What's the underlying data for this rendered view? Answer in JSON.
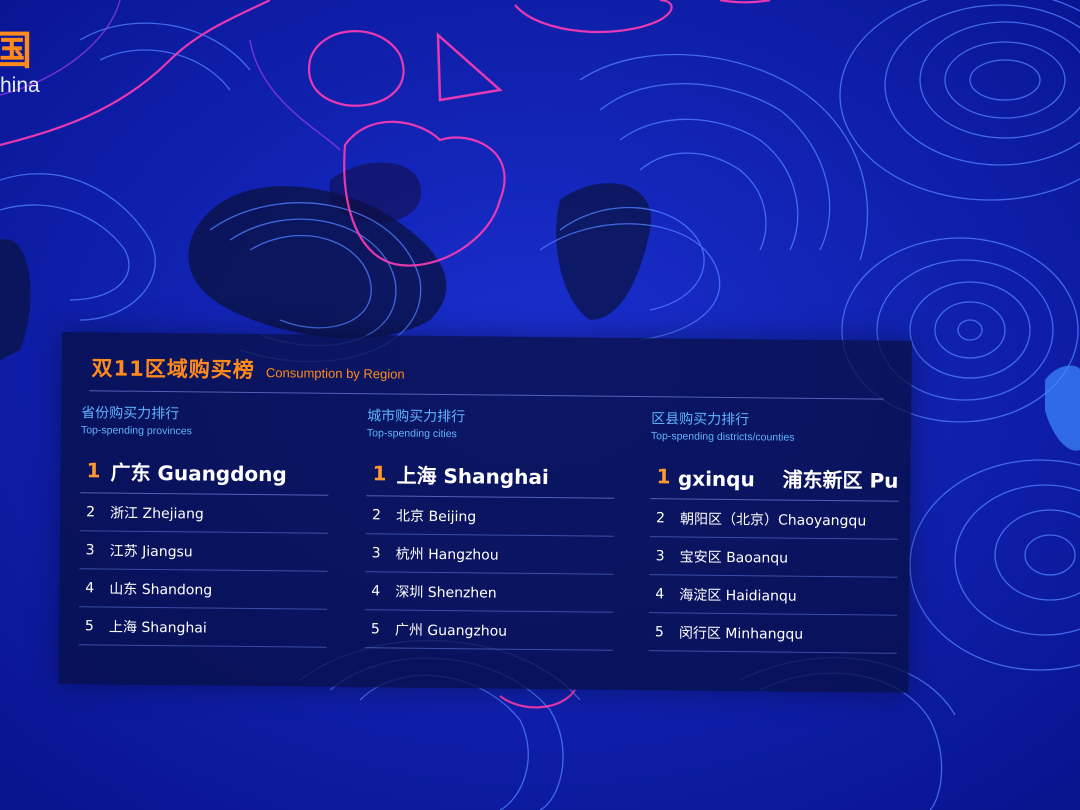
{
  "header": {
    "title_char": "国",
    "subtitle": "hina"
  },
  "panel": {
    "title_zh": "双11区域购买榜",
    "title_en": "Consumption by Region",
    "columns": [
      {
        "title": "省份购买力排行",
        "subtitle": "Top-spending provinces",
        "rows": [
          {
            "rank": "1",
            "name": "广东 Guangdong"
          },
          {
            "rank": "2",
            "name": "浙江 Zhejiang"
          },
          {
            "rank": "3",
            "name": "江苏 Jiangsu"
          },
          {
            "rank": "4",
            "name": "山东 Shandong"
          },
          {
            "rank": "5",
            "name": "上海 Shanghai"
          }
        ]
      },
      {
        "title": "城市购买力排行",
        "subtitle": "Top-spending cities",
        "rows": [
          {
            "rank": "1",
            "name": "上海 Shanghai"
          },
          {
            "rank": "2",
            "name": "北京 Beijing"
          },
          {
            "rank": "3",
            "name": "杭州 Hangzhou"
          },
          {
            "rank": "4",
            "name": "深圳 Shenzhen"
          },
          {
            "rank": "5",
            "name": "广州 Guangzhou"
          }
        ]
      },
      {
        "title": "区县购买力排行",
        "subtitle": "Top-spending districts/counties",
        "rows": [
          {
            "rank": "1",
            "name": "gxinqu    浦东新区 Pu"
          },
          {
            "rank": "2",
            "name": "朝阳区（北京）Chaoyangqu"
          },
          {
            "rank": "3",
            "name": "宝安区 Baoanqu"
          },
          {
            "rank": "4",
            "name": "海淀区 Haidianqu"
          },
          {
            "rank": "5",
            "name": "闵行区 Minhangqu"
          }
        ]
      }
    ]
  },
  "colors": {
    "background": "#0a1a9e",
    "accent_orange": "#ff8a1c",
    "heading_blue": "#5fb3ff",
    "contour_blue": "#4f7dff",
    "contour_pink": "#ff3cb4"
  }
}
